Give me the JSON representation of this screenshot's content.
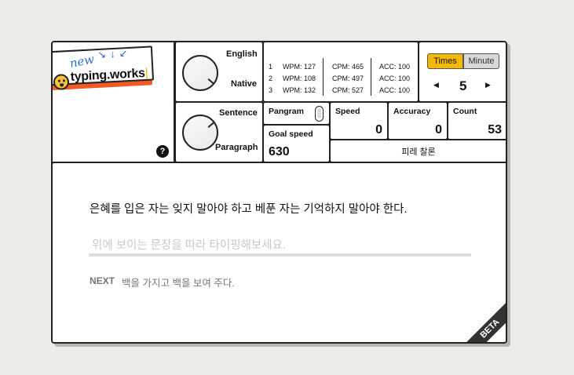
{
  "logo": {
    "new_label": "new",
    "brand": "typing.works",
    "cursor": "|"
  },
  "help_label": "?",
  "language": {
    "english": "English",
    "native": "Native"
  },
  "mode": {
    "sentence": "Sentence",
    "paragraph": "Paragraph"
  },
  "records": [
    {
      "rank": "1",
      "wpm": "WPM: 127",
      "cpm": "CPM: 465",
      "acc": "ACC: 100"
    },
    {
      "rank": "2",
      "wpm": "WPM: 108",
      "cpm": "CPM: 497",
      "acc": "ACC: 100"
    },
    {
      "rank": "3",
      "wpm": "WPM: 132",
      "cpm": "CPM: 527",
      "acc": "ACC: 100"
    }
  ],
  "test_mode": {
    "tabs": [
      {
        "label": "Times",
        "active": true
      },
      {
        "label": "Minute",
        "active": false
      }
    ],
    "value": "5",
    "prev_icon": "◀",
    "next_icon": "▶"
  },
  "pangram": {
    "label": "Pangram"
  },
  "goal_speed": {
    "label": "Goal speed",
    "value": "630"
  },
  "speed": {
    "label": "Speed",
    "value": "0"
  },
  "accuracy": {
    "label": "Accuracy",
    "value": "0"
  },
  "count": {
    "label": "Count",
    "value": "53"
  },
  "source": {
    "label": "피레 찰론"
  },
  "typing": {
    "sentence": "은혜를 입은 자는 잊지 말아야 하고 베푼 자는 기억하지 말아야 한다.",
    "placeholder": "위에 보이는 문장을 따라 타이핑해보세요.",
    "next_label": "NEXT",
    "next_sentence": "백을 가지고 백을 보여 주다."
  },
  "beta": "BETA",
  "colors": {
    "accent": "#f5b800",
    "logo_orange": "#f15a24",
    "new_blue": "#2a6ad8"
  }
}
